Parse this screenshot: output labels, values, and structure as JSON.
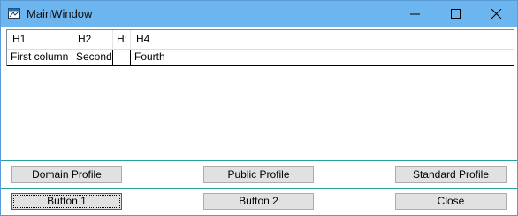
{
  "window": {
    "title": "MainWindow",
    "titlebar_color": "#6cb5ee"
  },
  "grid": {
    "columns": [
      "H1",
      "H2",
      "H:",
      "H4"
    ],
    "rows": [
      [
        "First column",
        "Second",
        "",
        "Fourth"
      ]
    ]
  },
  "profile_buttons": {
    "domain": "Domain Profile",
    "public": "Public Profile",
    "standard": "Standard Profile"
  },
  "action_buttons": {
    "button1": "Button 1",
    "button2": "Button 2",
    "close": "Close"
  },
  "icons": {
    "app": "window-app-icon",
    "minimize": "minimize-icon",
    "maximize": "maximize-icon",
    "close": "close-icon"
  },
  "colors": {
    "separator": "#2aa1a1",
    "button_bg": "#e1e1e1"
  }
}
